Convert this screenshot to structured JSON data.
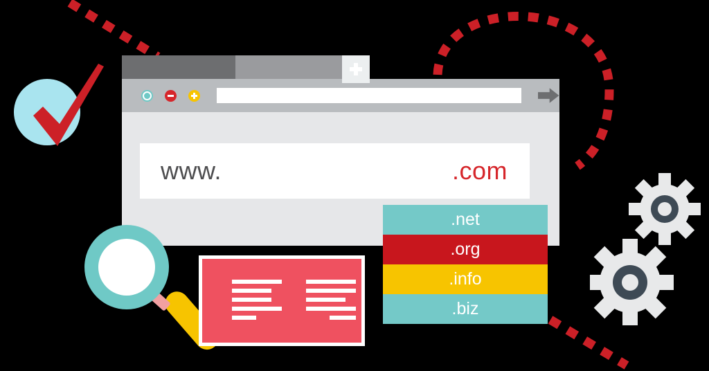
{
  "scene": {
    "title": "Domain name search illustration",
    "background": "#000000"
  },
  "browser": {
    "tabs": [
      {
        "name": "active-tab",
        "label": "",
        "color": "#6d6e70",
        "state": "active"
      },
      {
        "name": "inactive-tab",
        "label": "",
        "color": "#9a9b9e",
        "state": "inactive"
      }
    ],
    "new_tab_icon": "plus-icon",
    "toolbar": {
      "controls": [
        {
          "name": "record-button",
          "icon": "circle-dot-icon",
          "color": "#6fc9c6"
        },
        {
          "name": "minus-button",
          "icon": "minus-circle-icon",
          "color": "#d6262b"
        },
        {
          "name": "plus-button",
          "icon": "plus-circle-icon",
          "color": "#f7c400"
        }
      ],
      "address_bar": {
        "value": "",
        "placeholder": ""
      },
      "go_icon": "arrow-right-icon",
      "bar_color": "#b9bcbf"
    },
    "viewport_color": "#e6e7e9"
  },
  "domain_field": {
    "prefix": "www.",
    "suffix": ".com",
    "prefix_color": "#4d4d4f",
    "suffix_color": "#d6262b",
    "background": "#ffffff"
  },
  "tld_dropdown": {
    "items": [
      {
        "label": ".net",
        "color": "#74c9c8"
      },
      {
        "label": ".org",
        "color": "#c8161d"
      },
      {
        "label": ".info",
        "color": "#f7c400"
      },
      {
        "label": ".biz",
        "color": "#74c9c8"
      }
    ],
    "text_color": "#ffffff"
  },
  "decorations": {
    "check_badge": {
      "name": "verified-check-badge",
      "circle_color": "#a9e4ef",
      "check_color": "#cc2027"
    },
    "magnifier": {
      "name": "magnifier",
      "ring_color": "#6fc9c6",
      "lens_color": "#ffffff",
      "neck_color": "#f2a0a2",
      "handle_color": "#f7c400"
    },
    "content_card": {
      "name": "content-card",
      "border_color": "#ffffff",
      "fill_color": "#ef5160",
      "line_color": "#ffffff",
      "left_column_line_widths": [
        72,
        57,
        57,
        72,
        35
      ],
      "right_column_line_widths": [
        72,
        72,
        57,
        72,
        38
      ]
    },
    "gears": {
      "name": "settings-gears",
      "body_color": "#e8e9ea",
      "hub_color": "#3e4a55",
      "count": 2
    },
    "dashed_paths": {
      "color": "#cc2027",
      "paths": [
        {
          "name": "dashed-path-top-left"
        },
        {
          "name": "dashed-path-arc-right"
        },
        {
          "name": "dashed-path-bottom-right"
        }
      ]
    }
  }
}
